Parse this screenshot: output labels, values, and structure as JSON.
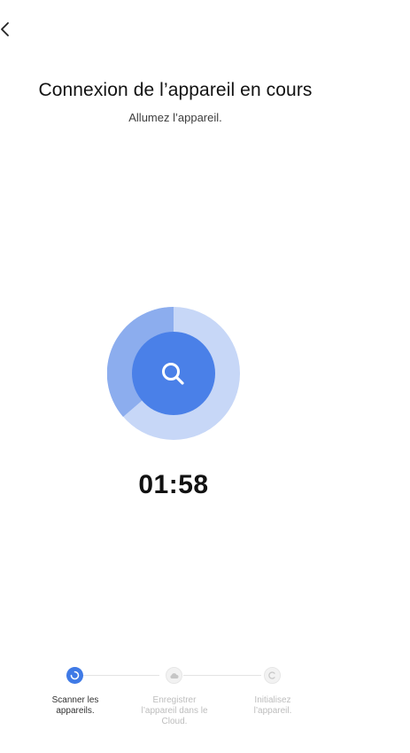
{
  "header": {
    "back_icon": "chevron-left-icon",
    "title": "Connexion de l’appareil en cours",
    "subtitle": "Allumez l’appareil."
  },
  "scanner": {
    "icon": "search-icon",
    "colors": {
      "outer": "#c9d8f8",
      "mid": "#8fb0ee",
      "inner": "#4a82e8"
    }
  },
  "timer": {
    "value": "01:58"
  },
  "steps": [
    {
      "label": "Scanner les appareils.",
      "icon": "scan-spinner-icon",
      "state": "active"
    },
    {
      "label": "Enregistrer l’appareil dans le Cloud.",
      "icon": "cloud-icon",
      "state": "inactive"
    },
    {
      "label": "Initialisez l’appareil.",
      "icon": "init-icon",
      "state": "inactive"
    }
  ],
  "colors": {
    "accent": "#3f7ae6",
    "inactive_text": "#bdbdbd"
  }
}
